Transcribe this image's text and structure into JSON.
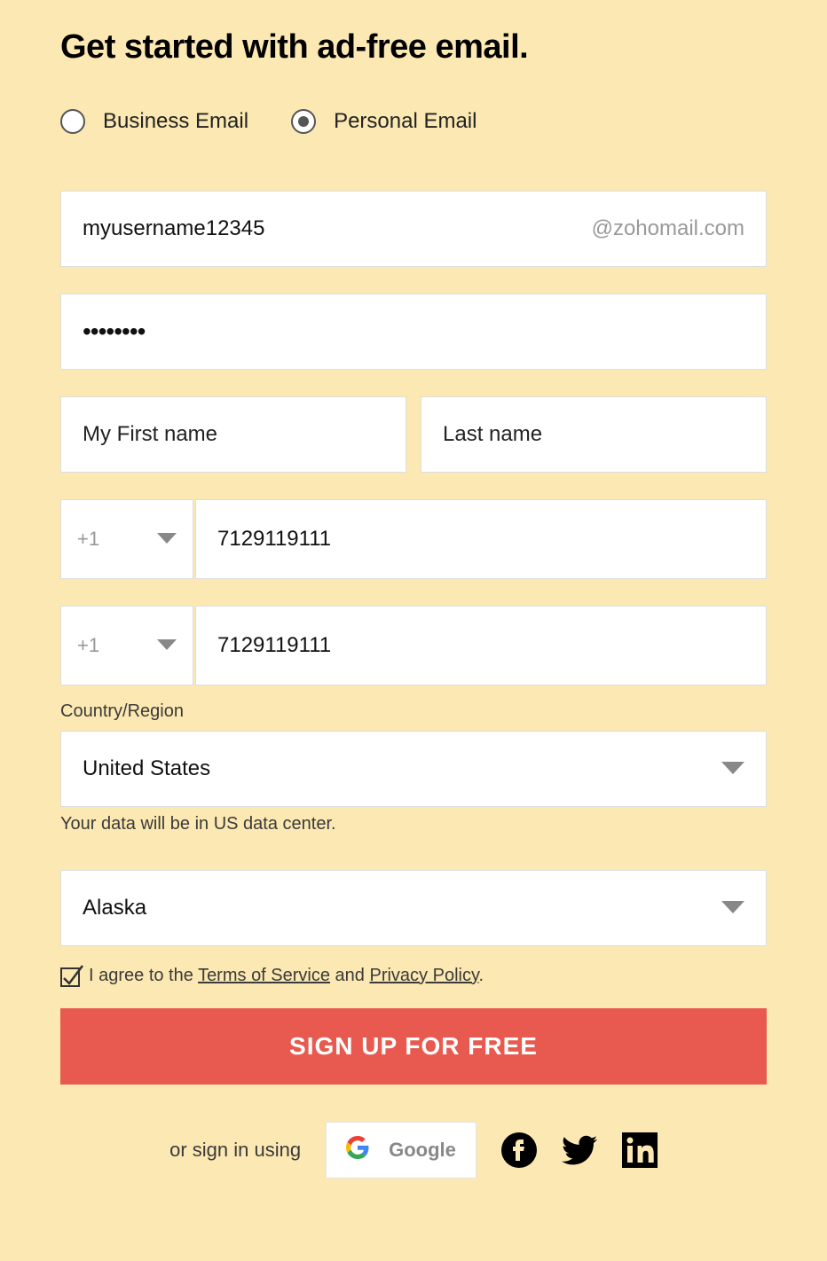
{
  "title": "Get started with ad-free email.",
  "emailType": {
    "business": {
      "label": "Business Email",
      "selected": false
    },
    "personal": {
      "label": "Personal Email",
      "selected": true
    }
  },
  "form": {
    "username": {
      "value": "myusername12345",
      "suffix": "@zohomail.com"
    },
    "password": {
      "masked": "••••••••"
    },
    "firstName": {
      "value": "My First name"
    },
    "lastName": {
      "placeholder": "Last name"
    },
    "phone1": {
      "code": "+1",
      "number": "7129119111"
    },
    "phone2": {
      "code": "+1",
      "number": "7129119111"
    },
    "country": {
      "label": "Country/Region",
      "value": "United States",
      "helper": "Your data will be in US data center."
    },
    "state": {
      "value": "Alaska"
    },
    "agree": {
      "prefix": "I agree to the ",
      "tos": "Terms of Service",
      "mid": " and ",
      "privacy": "Privacy Policy",
      "suffix": "."
    },
    "submit": "SIGN UP FOR FREE"
  },
  "signin": {
    "text": "or sign in using",
    "google": "Google"
  }
}
